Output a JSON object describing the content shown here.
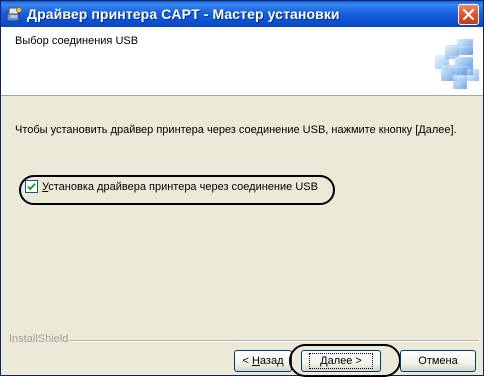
{
  "window": {
    "title": "Драйвер принтера CAPT - Мастер установки",
    "icon": "installer-icon"
  },
  "header": {
    "title": "Выбор соединения USB",
    "logo": "installshield-boxes-icon"
  },
  "content": {
    "instruction": "Чтобы установить драйвер принтера через соединение USB, нажмите кнопку [Далее].",
    "checkbox": {
      "label_underlined": "У",
      "label_rest": "становка драйвера принтера через соединение USB",
      "checked": true
    }
  },
  "footer": {
    "brand": "InstallShield",
    "back_prefix": "< ",
    "back_underlined": "Н",
    "back_rest": "азад",
    "next_underlined": "Д",
    "next_rest": "алее >",
    "cancel": "Отмена"
  },
  "colors": {
    "titlebar": "#0b4fd1",
    "dialog_bg": "#ece9d8",
    "close_button": "#d8542f"
  }
}
